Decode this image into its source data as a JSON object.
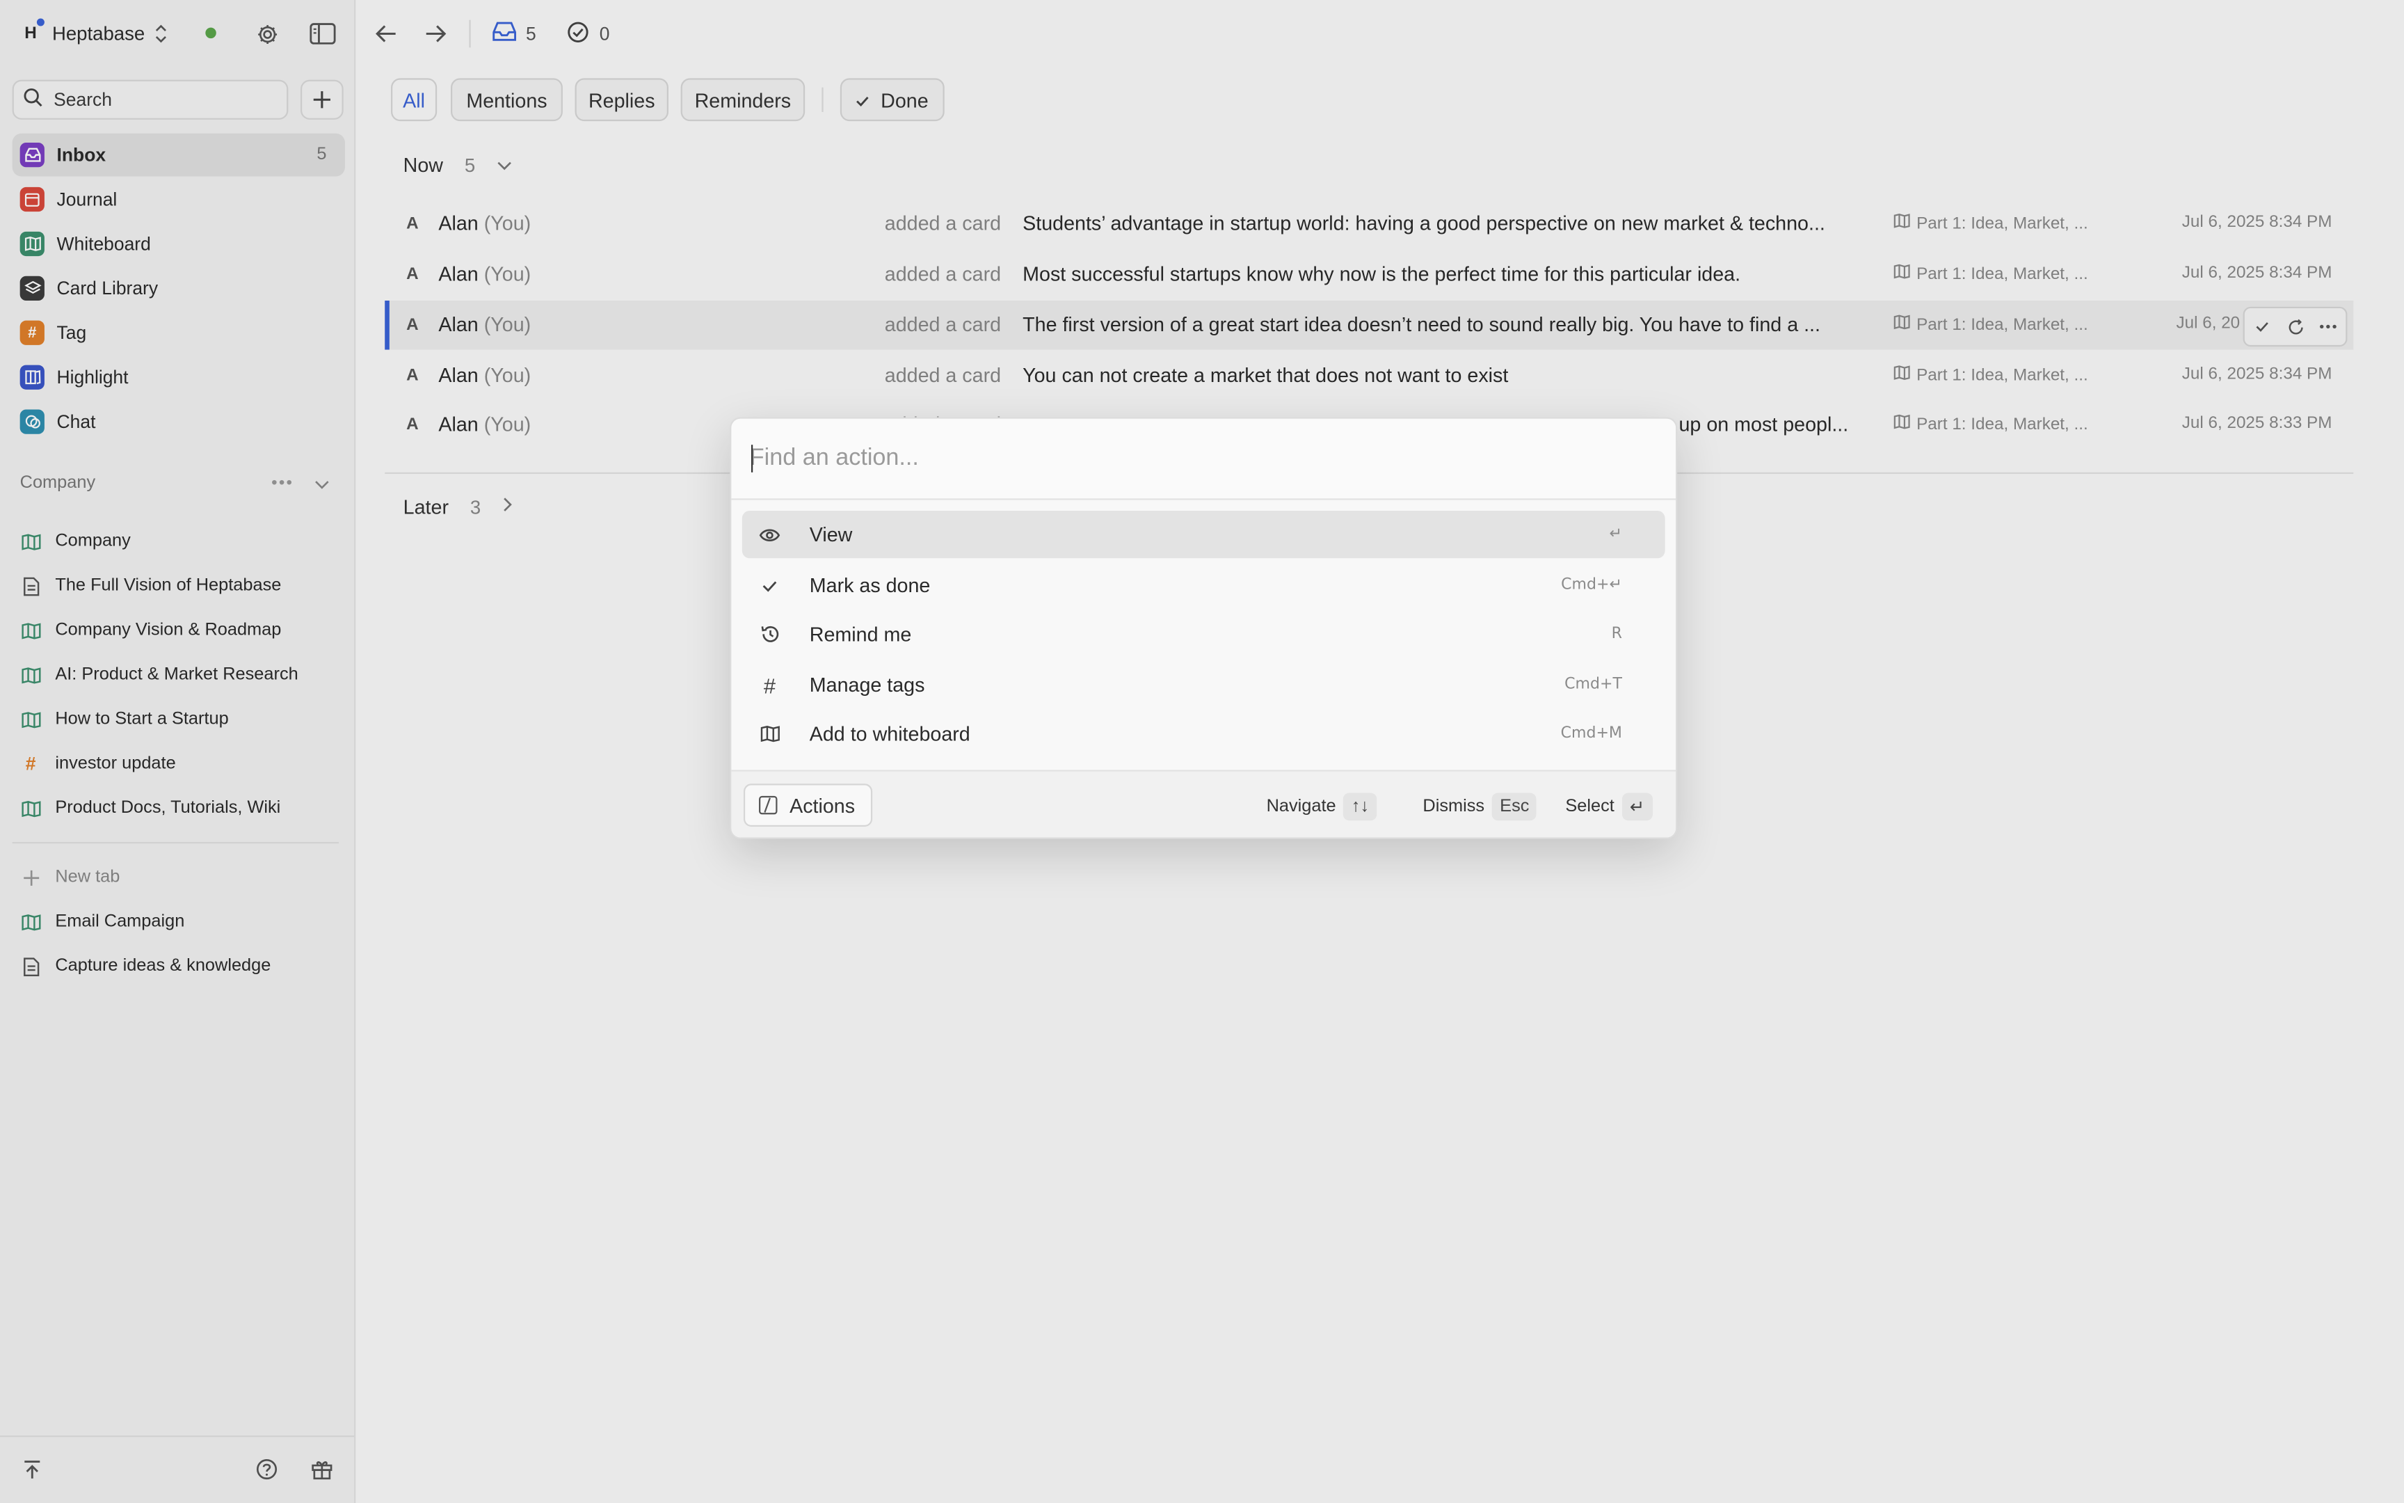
{
  "workspace": {
    "logo_letter": "H",
    "name": "Heptabase"
  },
  "sidebar": {
    "search_label": "Search",
    "nav": [
      {
        "label": "Inbox",
        "count": "5",
        "icon": "inbox-icon",
        "color": "#7b3fc4"
      },
      {
        "label": "Journal",
        "icon": "calendar-icon",
        "color": "#d9483b"
      },
      {
        "label": "Whiteboard",
        "icon": "whiteboard-icon",
        "color": "#3c8f6e"
      },
      {
        "label": "Card Library",
        "icon": "layers-icon",
        "color": "#3d3d3d"
      },
      {
        "label": "Tag",
        "icon": "hash-icon",
        "color": "#e0802a"
      },
      {
        "label": "Highlight",
        "icon": "highlight-icon",
        "color": "#3a56c9"
      },
      {
        "label": "Chat",
        "icon": "chat-icon",
        "color": "#2f8fb0"
      }
    ],
    "section_title": "Company",
    "tree": [
      {
        "label": "Company",
        "icon": "whiteboard-icon"
      },
      {
        "label": "The Full Vision of Heptabase",
        "icon": "document-icon"
      },
      {
        "label": "Company Vision & Roadmap",
        "icon": "whiteboard-icon"
      },
      {
        "label": "AI: Product & Market Research",
        "icon": "whiteboard-icon"
      },
      {
        "label": "How to Start a Startup",
        "icon": "whiteboard-icon"
      },
      {
        "label": "investor update",
        "icon": "hash-icon"
      },
      {
        "label": "Product Docs, Tutorials, Wiki",
        "icon": "whiteboard-icon"
      }
    ],
    "new_tab": "New tab",
    "tabs": [
      {
        "label": "Email Campaign",
        "icon": "whiteboard-icon"
      },
      {
        "label": "Capture ideas & knowledge",
        "icon": "document-icon"
      }
    ]
  },
  "topbar": {
    "inbox_count": "5",
    "done_count": "0"
  },
  "filters": {
    "all": "All",
    "mentions": "Mentions",
    "replies": "Replies",
    "reminders": "Reminders",
    "done": "Done"
  },
  "groups": {
    "now": {
      "label": "Now",
      "count": "5"
    },
    "later": {
      "label": "Later",
      "count": "3"
    }
  },
  "rows": [
    {
      "avatar": "A",
      "name": "Alan",
      "you": "(You)",
      "verb": "added a card",
      "text": "Students’ advantage in startup world: having a good perspective on new market & techno...",
      "whiteboard": "Part 1: Idea, Market, ...",
      "date": "Jul 6, 2025 8:34 PM"
    },
    {
      "avatar": "A",
      "name": "Alan",
      "you": "(You)",
      "verb": "added a card",
      "text": "Most successful startups know why now is the perfect time for this particular idea.",
      "whiteboard": "Part 1: Idea, Market, ...",
      "date": "Jul 6, 2025 8:34 PM"
    },
    {
      "avatar": "A",
      "name": "Alan",
      "you": "(You)",
      "verb": "added a card",
      "text": "The first version of a great start idea doesn’t need to sound really big. You have to find a ...",
      "whiteboard": "Part 1: Idea, Market, ...",
      "date": "Jul 6, 20"
    },
    {
      "avatar": "A",
      "name": "Alan",
      "you": "(You)",
      "verb": "added a card",
      "text": "You can not create a market that does not want to exist",
      "whiteboard": "Part 1: Idea, Market, ...",
      "date": "Jul 6, 2025 8:34 PM"
    },
    {
      "avatar": "A",
      "name": "Alan",
      "you": "(You)",
      "verb": "added a card",
      "text": "up on most peopl...",
      "whiteboard": "Part 1: Idea, Market, ...",
      "date": "Jul 6, 2025 8:33 PM"
    }
  ],
  "palette": {
    "placeholder": "Find an action...",
    "options": [
      {
        "label": "View",
        "key": "↵",
        "icon": "eye-icon"
      },
      {
        "label": "Mark as done",
        "key": "Cmd+↵",
        "icon": "check-icon"
      },
      {
        "label": "Remind me",
        "key": "R",
        "icon": "history-icon"
      },
      {
        "label": "Manage tags",
        "key": "Cmd+T",
        "icon": "hash-icon"
      },
      {
        "label": "Add to whiteboard",
        "key": "Cmd+M",
        "icon": "whiteboard-icon"
      }
    ],
    "footer": {
      "actions": "Actions",
      "navigate": "Navigate",
      "navigate_key": "↑↓",
      "dismiss": "Dismiss",
      "dismiss_key": "Esc",
      "select": "Select",
      "select_key": "↵"
    }
  }
}
